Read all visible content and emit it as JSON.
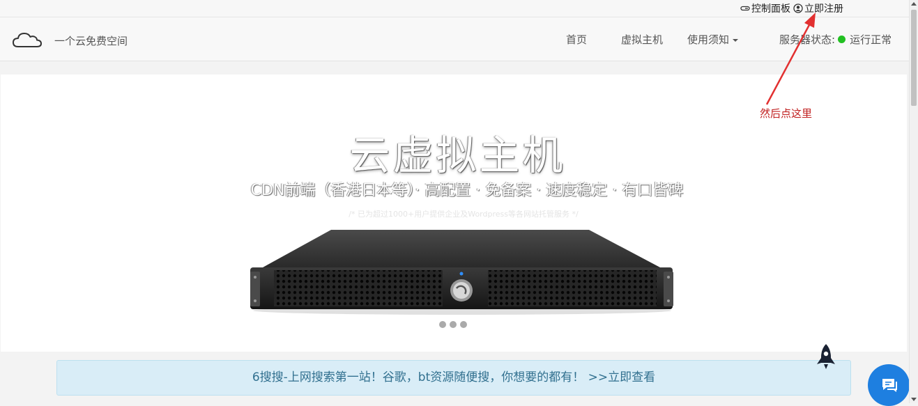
{
  "topbar": {
    "control_panel": "控制面板",
    "register": "立即注册"
  },
  "navbar": {
    "brand": "一个云免费空间",
    "items": [
      {
        "label": "首页"
      },
      {
        "label": "虚拟主机"
      },
      {
        "label": "使用须知"
      }
    ],
    "status_label": "服务器状态:",
    "status_value": "运行正常",
    "status_color": "#22c022"
  },
  "hero": {
    "title": "云虚拟主机",
    "subtitle": "CDN前端（香港日本等）· 高配置 · 免备案 · 速度稳定 · 有口皆碑",
    "note": "/* 已为超过1000+用户提供企业及Wordpress等各网站托管服务 */",
    "slides": 3
  },
  "banner": {
    "text": "6搜搜-上网搜索第一站！谷歌，bt资源随便搜，你想要的都有！ >>立即查看"
  },
  "annotation": {
    "text": "然后点这里",
    "color": "#c01e1e"
  },
  "icons": [
    "key-icon",
    "user-icon",
    "cloud-logo-icon",
    "rocket-icon",
    "chat-icon"
  ]
}
